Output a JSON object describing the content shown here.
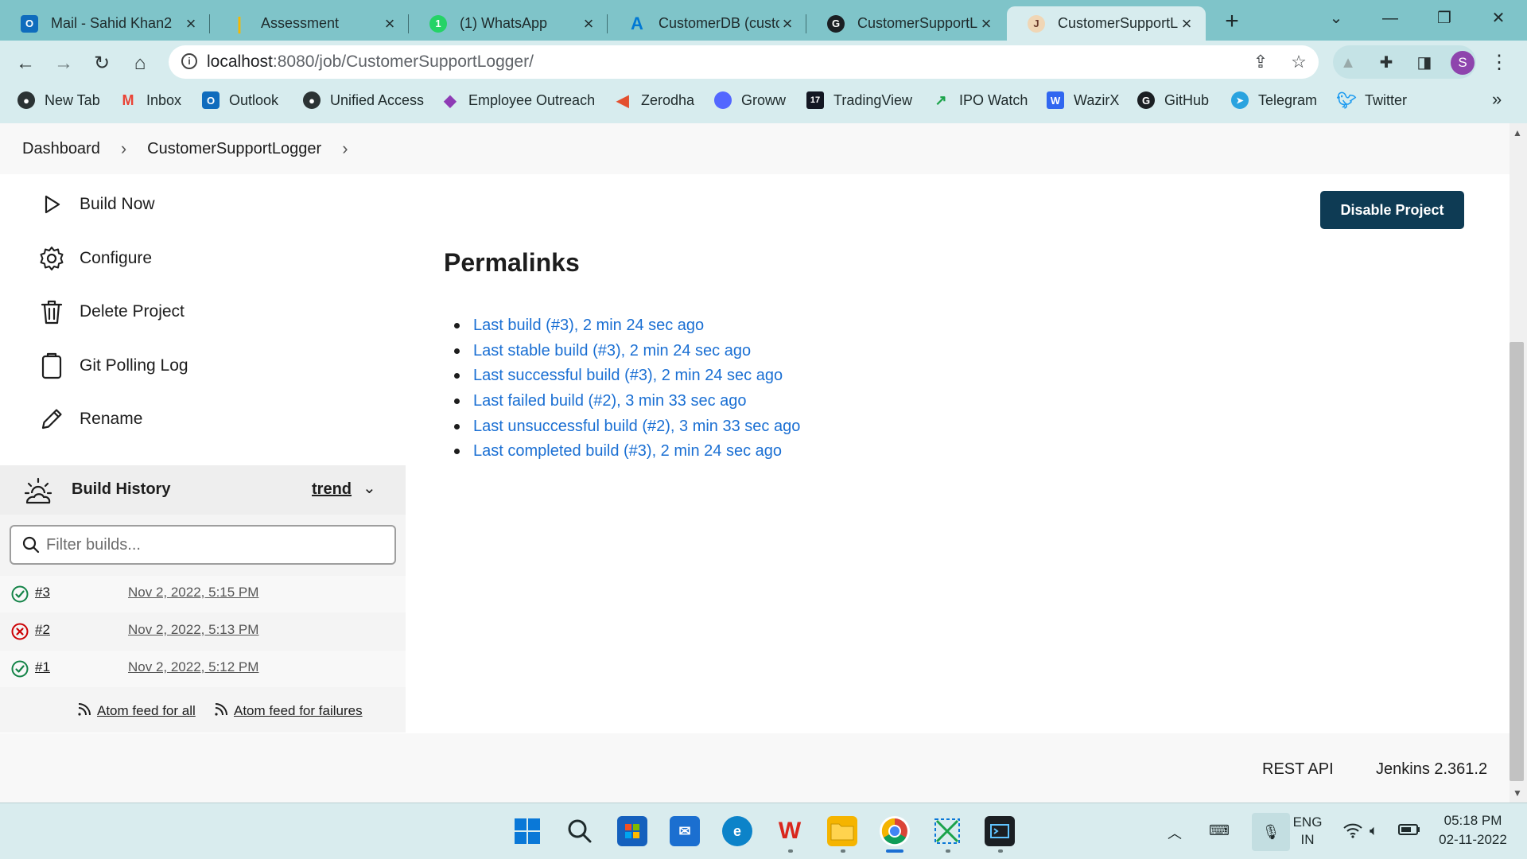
{
  "browser": {
    "tabs": [
      {
        "label": "Mail - Sahid Khan2",
        "fav_color": "#0f6cbd",
        "fav_text": "O"
      },
      {
        "label": "Assessment",
        "fav_color": "#f5b800",
        "fav_text": "|"
      },
      {
        "label": "(1) WhatsApp",
        "fav_color": "#25d366",
        "fav_text": "1"
      },
      {
        "label": "CustomerDB (custo",
        "fav_color": "#0078d4",
        "fav_text": "A"
      },
      {
        "label": "CustomerSupportLo",
        "fav_color": "#1b1f23",
        "fav_text": "G"
      },
      {
        "label": "CustomerSupportLo",
        "fav_color": "#d24939",
        "fav_text": "J"
      }
    ],
    "active_tab_index": 5,
    "url": {
      "host": "localhost",
      "path": ":8080/job/CustomerSupportLogger/"
    },
    "profile_initial": "S",
    "bookmarks": [
      {
        "label": "New Tab",
        "color": "#2b3334",
        "glyph": "●"
      },
      {
        "label": "Inbox",
        "color": "#ea4335",
        "glyph": "M"
      },
      {
        "label": "Outlook",
        "color": "#0f6cbd",
        "glyph": "O"
      },
      {
        "label": "Unified Access",
        "color": "#2b3334",
        "glyph": "●"
      },
      {
        "label": "Employee Outreach",
        "color": "#8e3bb5",
        "glyph": "◆"
      },
      {
        "label": "Zerodha",
        "color": "#e3502f",
        "glyph": "<"
      },
      {
        "label": "Groww",
        "color": "#5367ff",
        "glyph": "●"
      },
      {
        "label": "TradingView",
        "color": "#131722",
        "glyph": "17"
      },
      {
        "label": "IPO Watch",
        "color": "#1aa34a",
        "glyph": "↗"
      },
      {
        "label": "WazirX",
        "color": "#3067f0",
        "glyph": "W"
      },
      {
        "label": "GitHub",
        "color": "#1b1f23",
        "glyph": "G"
      },
      {
        "label": "Telegram",
        "color": "#2aa3df",
        "glyph": "➤"
      },
      {
        "label": "Twitter",
        "color": "#1d9bf0",
        "glyph": "t"
      }
    ]
  },
  "breadcrumb": {
    "items": [
      "Dashboard",
      "CustomerSupportLogger"
    ]
  },
  "sidebar": {
    "tasks": [
      {
        "label": "Build Now",
        "icon": "play-icon"
      },
      {
        "label": "Configure",
        "icon": "gear-icon"
      },
      {
        "label": "Delete Project",
        "icon": "trash-icon"
      },
      {
        "label": "Git Polling Log",
        "icon": "clipboard-icon"
      },
      {
        "label": "Rename",
        "icon": "pencil-icon"
      }
    ]
  },
  "build_history": {
    "title": "Build History",
    "trend_label": "trend",
    "filter_placeholder": "Filter builds...",
    "builds": [
      {
        "number": "#3",
        "time": "Nov 2, 2022, 5:15 PM",
        "status": "success"
      },
      {
        "number": "#2",
        "time": "Nov 2, 2022, 5:13 PM",
        "status": "failure"
      },
      {
        "number": "#1",
        "time": "Nov 2, 2022, 5:12 PM",
        "status": "success"
      }
    ],
    "feed_all": "Atom feed for all",
    "feed_failures": "Atom feed for failures"
  },
  "main": {
    "disable_button": "Disable Project",
    "permalinks_title": "Permalinks",
    "permalinks": [
      "Last build (#3), 2 min 24 sec ago",
      "Last stable build (#3), 2 min 24 sec ago",
      "Last successful build (#3), 2 min 24 sec ago",
      "Last failed build (#2), 3 min 33 sec ago",
      "Last unsuccessful build (#2), 3 min 33 sec ago",
      "Last completed build (#3), 2 min 24 sec ago"
    ]
  },
  "footer": {
    "rest_api": "REST API",
    "version": "Jenkins 2.361.2"
  },
  "taskbar": {
    "lang_top": "ENG",
    "lang_bottom": "IN",
    "time": "05:18 PM",
    "date": "02-11-2022"
  },
  "colors": {
    "chrome_frame": "#7fc4c9",
    "chrome_toolbar": "#d7ecee",
    "jenkins_primary": "#0e3b54",
    "link": "#1a6fd3",
    "success": "#138347",
    "failure": "#cc0003"
  }
}
